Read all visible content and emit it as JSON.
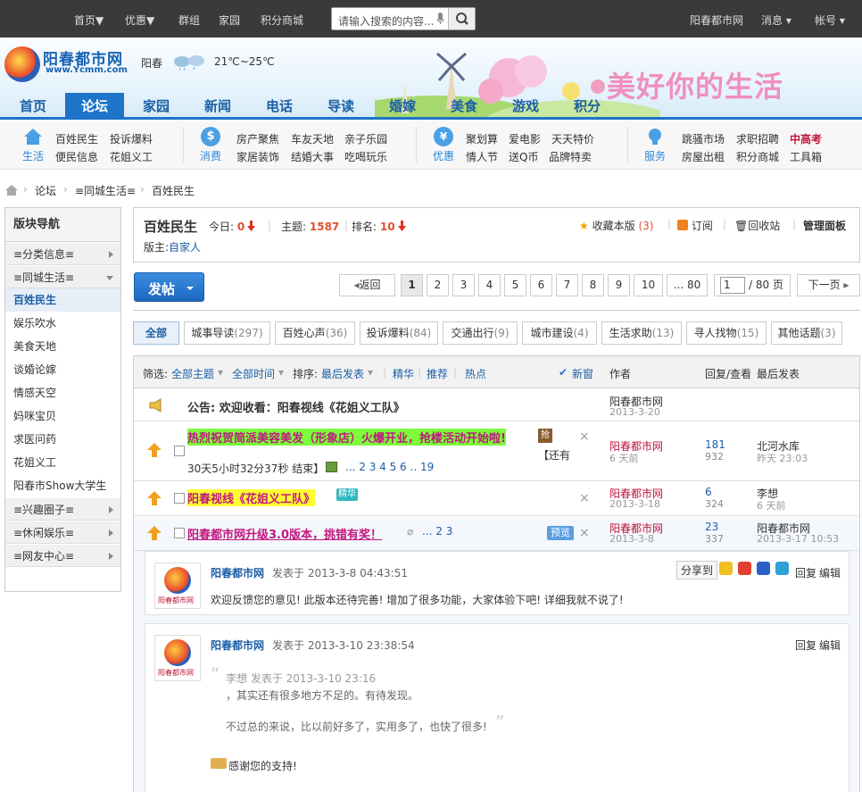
{
  "topbar": {
    "nav": [
      "首页▼",
      "优惠▼",
      "群组",
      "家园",
      "积分商城"
    ],
    "search_placeholder": "请输入搜索的内容...",
    "site_name": "阳春都市网",
    "messages": "消息 ▾",
    "account": "帐号 ▾"
  },
  "banner": {
    "logo_name": "阳春都市网",
    "logo_url": "www.Ycmm.com",
    "city": "阳春",
    "temperature": "21℃~25℃",
    "slogan": "美好你的生活"
  },
  "nav": {
    "tabs": [
      "首页",
      "论坛",
      "家园",
      "新闻",
      "电话",
      "导读",
      "婚嫁",
      "美食",
      "游戏",
      "积分"
    ],
    "active": "论坛"
  },
  "quicklinks": {
    "groups": [
      {
        "icon": "home-icon",
        "label": "生活",
        "links": [
          "百姓民生",
          "投诉爆料",
          "便民信息",
          "花姐义工"
        ]
      },
      {
        "icon": "coin-icon",
        "label": "消费",
        "links": [
          "房产聚焦",
          "车友天地",
          "亲子乐园",
          "家居装饰",
          "结婚大事",
          "吃喝玩乐"
        ]
      },
      {
        "icon": "money-bag-icon",
        "label": "优惠",
        "links": [
          "聚划算",
          "爱电影",
          "天天特价",
          "情人节",
          "送Q币",
          "品牌特卖"
        ]
      },
      {
        "icon": "lightbulb-icon",
        "label": "服务",
        "links": [
          "跳骚市场",
          "求职招聘",
          "中高考",
          "房屋出租",
          "积分商城",
          "工具箱"
        ]
      }
    ]
  },
  "breadcrumb": [
    "论坛",
    "≡同城生活≡",
    "百姓民生"
  ],
  "sidebar": {
    "title": "版块导航",
    "items": [
      {
        "label": "≡分类信息≡",
        "type": "group"
      },
      {
        "label": "≡同城生活≡",
        "type": "group-open"
      },
      {
        "label": "百姓民生",
        "type": "current"
      },
      {
        "label": "娱乐吹水",
        "type": "item"
      },
      {
        "label": "美食天地",
        "type": "item"
      },
      {
        "label": "谈婚论嫁",
        "type": "item"
      },
      {
        "label": "情感天空",
        "type": "item"
      },
      {
        "label": "妈咪宝贝",
        "type": "item"
      },
      {
        "label": "求医问药",
        "type": "item"
      },
      {
        "label": "花姐义工",
        "type": "item"
      },
      {
        "label": "阳春市Show大学生",
        "type": "item"
      },
      {
        "label": "≡兴趣圈子≡",
        "type": "group"
      },
      {
        "label": "≡休闲娱乐≡",
        "type": "group"
      },
      {
        "label": "≡网友中心≡",
        "type": "group"
      }
    ]
  },
  "forum": {
    "name": "百姓民生",
    "today_label": "今日:",
    "today": "0",
    "topics_label": "主题:",
    "topics": "1587",
    "rank_label": "排名:",
    "rank": "10",
    "moderator_label": "版主:",
    "moderator": "自家人",
    "favorite": "收藏本版",
    "favorite_count": "(3)",
    "subscribe": "订阅",
    "recycle": "回收站",
    "admin": "管理面板"
  },
  "post_button": "发帖",
  "pager": {
    "back": "返回",
    "pages": [
      "1",
      "2",
      "3",
      "4",
      "5",
      "6",
      "7",
      "8",
      "9",
      "10",
      "... 80"
    ],
    "current_input": "1",
    "total": "/ 80 页",
    "next": "下一页"
  },
  "filters": [
    {
      "label": "全部",
      "count": ""
    },
    {
      "label": "城事导读",
      "count": "(297)"
    },
    {
      "label": "百姓心声",
      "count": "(36)"
    },
    {
      "label": "投诉爆料",
      "count": "(84)"
    },
    {
      "label": "交通出行",
      "count": "(9)"
    },
    {
      "label": "城市建设",
      "count": "(4)"
    },
    {
      "label": "生活求助",
      "count": "(13)"
    },
    {
      "label": "寻人找物",
      "count": "(15)"
    },
    {
      "label": "其他话题",
      "count": "(3)"
    }
  ],
  "list_header": {
    "filter_label": "筛选:",
    "all_topics": "全部主题",
    "all_time": "全部时间",
    "sort_label": "排序:",
    "sort_value": "最后发表",
    "digest": "精华",
    "recommend": "推荐",
    "hot": "热点",
    "new_window": "新窗",
    "author": "作者",
    "reply_view": "回复/查看",
    "last_post": "最后发表"
  },
  "announcement": {
    "title": "公告: 欢迎收看：阳春视线《花姐义工队》",
    "author": "阳春都市网",
    "date": "2013-3-20"
  },
  "threads": [
    {
      "title": "热烈祝贺简派美容美发（形象店）火爆开业，抢楼活动开始啦!",
      "badge": "抢",
      "extra": "【还有",
      "timer": "30天5小时32分37秒 结束】",
      "pages": "... 2 3 4 5 6 .. 19",
      "author": "阳春都市网",
      "date": "6 天前",
      "replies": "181",
      "views": "932",
      "last_user": "北河水库",
      "last_time": "昨天 23:03"
    },
    {
      "title": "阳春视线《花姐义工队》",
      "badge": "精华",
      "author": "阳春都市网",
      "date": "2013-3-18",
      "replies": "6",
      "views": "324",
      "last_user": "李想",
      "last_time": "6 天前"
    },
    {
      "title": "阳春都市网升级3.0版本，挑错有奖！",
      "pages": "... 2 3",
      "preview": "预览",
      "author": "阳春都市网",
      "date": "2013-3-8",
      "replies": "23",
      "views": "337",
      "last_user": "阳春都市网",
      "last_time": "2013-3-17 10:53"
    }
  ],
  "posts": [
    {
      "author": "阳春都市网",
      "meta": "发表于  2013-3-8 04:43:51",
      "share_label": "分享到",
      "reply": "回复",
      "edit": "编辑",
      "body": "欢迎反馈您的意见! 此版本还待完善! 增加了很多功能，大家体验下吧! 详细我就不说了!",
      "avatar_text": "阳春都市网"
    },
    {
      "author": "阳春都市网",
      "meta": "发表于  2013-3-10 23:38:54",
      "reply": "回复",
      "edit": "编辑",
      "quote_head": "李想 发表于 2013-3-10 23:16",
      "quote_line1": "，其实还有很多地方不足的。有待发现。",
      "quote_line2": "不过总的来说，比以前好多了，实用多了，也快了很多!",
      "body": "感谢您的支持!",
      "avatar_text": "阳春都市网"
    }
  ]
}
